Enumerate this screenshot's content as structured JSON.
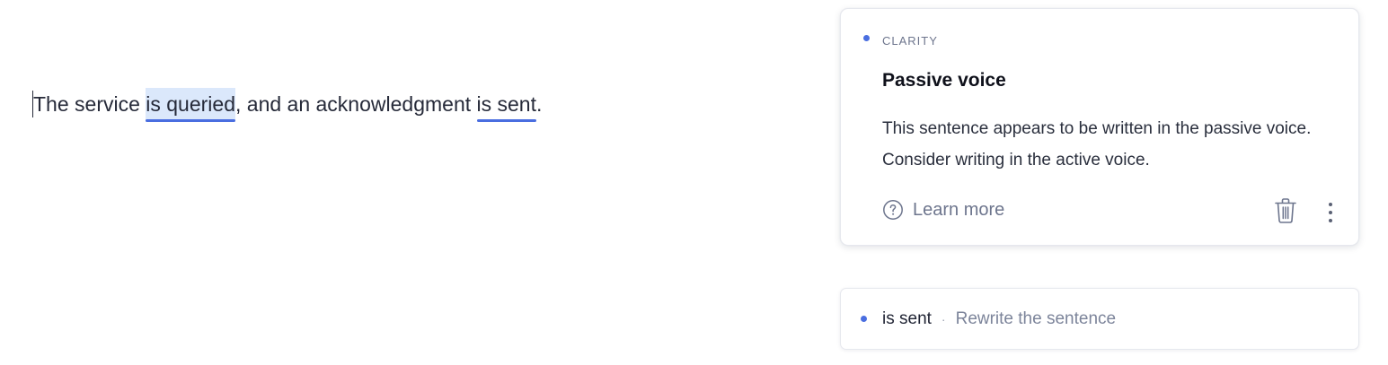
{
  "editor": {
    "segments": {
      "part1": "The service ",
      "highlight1": "is queried",
      "part2": ", and an acknowledgment ",
      "highlight2": "is sent",
      "part3": "."
    }
  },
  "card": {
    "category": "CLARITY",
    "title": "Passive voice",
    "description": "This sentence appears to be written in the passive voice. Consider writing in the active voice.",
    "learn_more_label": "Learn more",
    "icons": {
      "help": "question-circle-icon",
      "delete": "trash-icon",
      "more": "more-vertical-icon"
    }
  },
  "suggestion_row": {
    "phrase": "is sent",
    "separator": "·",
    "action": "Rewrite the sentence"
  },
  "colors": {
    "accent": "#4a6ee0",
    "highlight_background": "#dbe8fb",
    "muted_text": "#6d758d"
  }
}
